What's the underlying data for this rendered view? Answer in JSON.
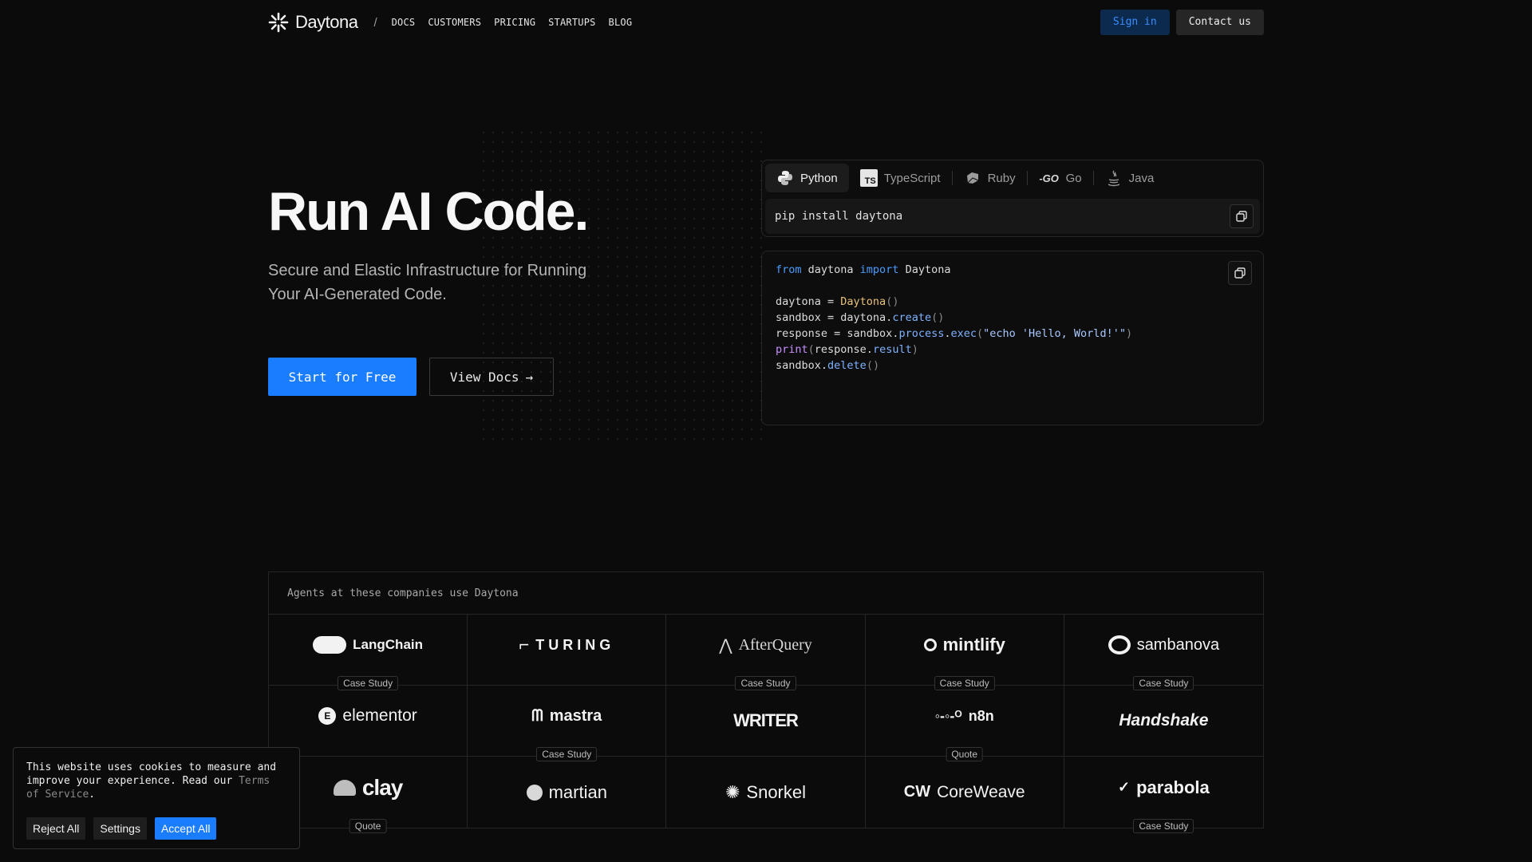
{
  "nav": {
    "brand": "Daytona",
    "separator": "/",
    "links": [
      "DOCS",
      "CUSTOMERS",
      "PRICING",
      "STARTUPS",
      "BLOG"
    ],
    "signin_label": "Sign in",
    "contact_label": "Contact us"
  },
  "hero": {
    "title": "Run AI Code.",
    "subtitle": "Secure and Elastic Infrastructure for Running Your AI-Generated Code.",
    "primary_cta": "Start for Free",
    "secondary_cta": "View Docs",
    "secondary_cta_arrow": "→"
  },
  "code_panel": {
    "tabs": [
      {
        "label": "Python",
        "icon": "python-icon",
        "active": true
      },
      {
        "label": "TypeScript",
        "icon": "typescript-icon",
        "active": false
      },
      {
        "label": "Ruby",
        "icon": "ruby-icon",
        "active": false
      },
      {
        "label": "Go",
        "icon": "go-icon",
        "active": false
      },
      {
        "label": "Java",
        "icon": "java-icon",
        "active": false
      }
    ],
    "install_command": "pip install daytona",
    "code_lines": [
      "from daytona import Daytona",
      "",
      "daytona = Daytona()",
      "sandbox = daytona.create()",
      "response = sandbox.process.exec(\"echo 'Hello, World!'\")",
      "print(response.result)",
      "sandbox.delete()"
    ]
  },
  "companies": {
    "heading": "Agents at these companies use Daytona",
    "items": [
      {
        "name": "LangChain",
        "badge": "Case Study"
      },
      {
        "name": "TURING",
        "badge": ""
      },
      {
        "name": "AfterQuery",
        "badge": "Case Study"
      },
      {
        "name": "mintlify",
        "badge": "Case Study"
      },
      {
        "name": "sambanova",
        "badge": "Case Study"
      },
      {
        "name": "elementor",
        "badge": ""
      },
      {
        "name": "mastra",
        "badge": "Case Study"
      },
      {
        "name": "WRITER",
        "badge": ""
      },
      {
        "name": "n8n",
        "badge": "Quote"
      },
      {
        "name": "Handshake",
        "badge": ""
      },
      {
        "name": "clay",
        "badge": "Quote"
      },
      {
        "name": "martian",
        "badge": ""
      },
      {
        "name": "Snorkel",
        "badge": ""
      },
      {
        "name": "CoreWeave",
        "badge": ""
      },
      {
        "name": "parabola",
        "badge": "Case Study"
      }
    ]
  },
  "cookie": {
    "text": "This website uses cookies to measure and improve your experience. Read our ",
    "link": "Terms of Service",
    "suffix": ".",
    "reject": "Reject All",
    "settings": "Settings",
    "accept": "Accept All"
  },
  "colors": {
    "accent": "#1a7cff",
    "background": "#0b0b0b"
  }
}
